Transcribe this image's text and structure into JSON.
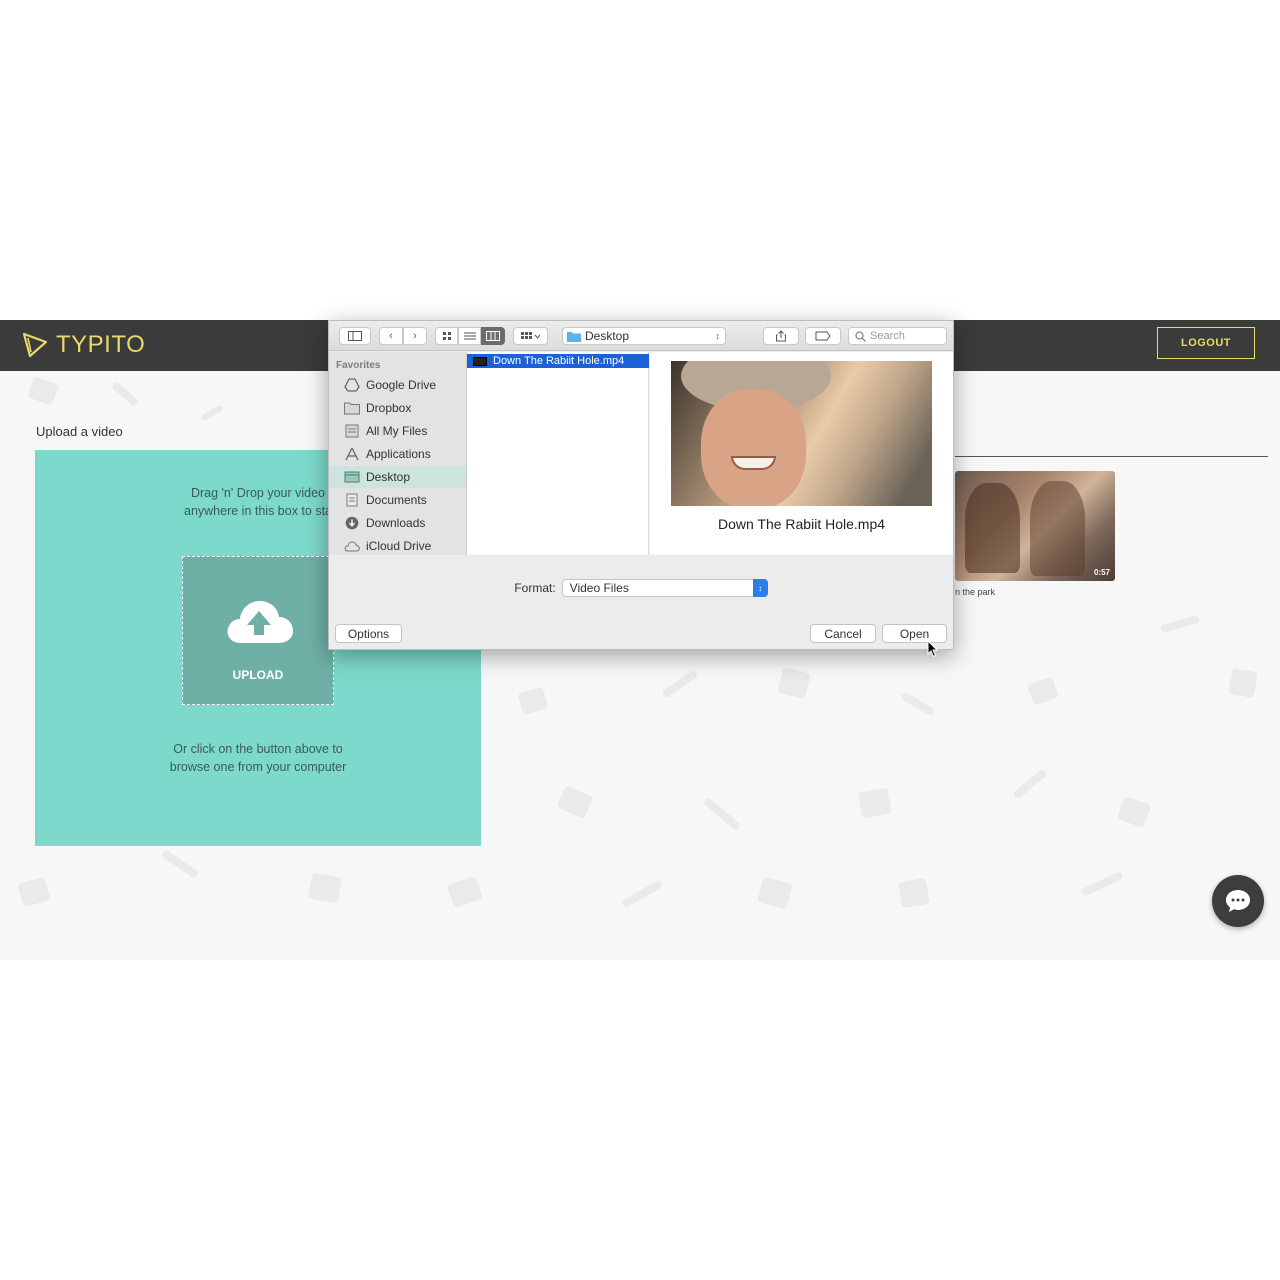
{
  "app": {
    "logo_text": "TYPITO",
    "logout_label": "LOGOUT",
    "accent_color": "#e7d96a",
    "header_color": "#3b3b3b"
  },
  "upload_panel": {
    "title": "Upload a video",
    "drag_text_line1": "Drag 'n' Drop your video",
    "drag_text_line2": "anywhere in this box to sta",
    "button_label": "UPLOAD",
    "browse_line1": "Or click on the button above to",
    "browse_line2": "browse one from your computer",
    "panel_color": "#7dd9cb"
  },
  "recent_video": {
    "duration": "0:57",
    "caption": "n the park"
  },
  "dialog": {
    "toolbar": {
      "location": "Desktop",
      "search_placeholder": "Search"
    },
    "sidebar": {
      "section_label": "Favorites",
      "items": [
        {
          "label": "Google Drive",
          "icon": "google-drive-icon"
        },
        {
          "label": "Dropbox",
          "icon": "folder-icon"
        },
        {
          "label": "All My Files",
          "icon": "all-files-icon"
        },
        {
          "label": "Applications",
          "icon": "applications-icon"
        },
        {
          "label": "Desktop",
          "icon": "desktop-icon",
          "selected": true
        },
        {
          "label": "Documents",
          "icon": "documents-icon"
        },
        {
          "label": "Downloads",
          "icon": "downloads-icon"
        },
        {
          "label": "iCloud Drive",
          "icon": "cloud-icon"
        }
      ]
    },
    "selected_file": "Down The Rabiit Hole.mp4",
    "preview_name": "Down The Rabiit Hole.mp4",
    "format_label": "Format:",
    "format_value": "Video Files",
    "options_label": "Options",
    "cancel_label": "Cancel",
    "open_label": "Open"
  }
}
